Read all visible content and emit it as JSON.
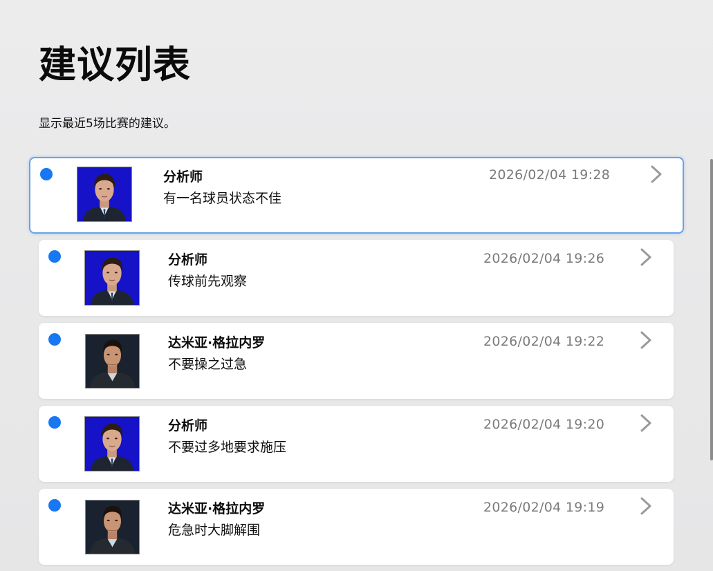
{
  "page": {
    "title": "建议列表",
    "subtitle": "显示最近5场比赛的建议。"
  },
  "colors": {
    "unread_dot": "#1877f2",
    "selected_border": "#6aa3e6",
    "timestamp": "#7b7b7b",
    "avatar_bg": "#1512c8"
  },
  "suggestions": [
    {
      "name": "分析师",
      "message": "有一名球员状态不佳",
      "timestamp": "2026/02/04 19:28",
      "avatar": "analyst-portrait",
      "unread": true,
      "selected": true
    },
    {
      "name": "分析师",
      "message": "传球前先观察",
      "timestamp": "2026/02/04 19:26",
      "avatar": "analyst-portrait",
      "unread": true,
      "selected": false
    },
    {
      "name": "达米亚·格拉内罗",
      "message": "不要操之过急",
      "timestamp": "2026/02/04 19:22",
      "avatar": "coach-portrait",
      "unread": true,
      "selected": false
    },
    {
      "name": "分析师",
      "message": "不要过多地要求施压",
      "timestamp": "2026/02/04 19:20",
      "avatar": "analyst-portrait",
      "unread": true,
      "selected": false
    },
    {
      "name": "达米亚·格拉内罗",
      "message": "危急时大脚解围",
      "timestamp": "2026/02/04 19:19",
      "avatar": "coach-portrait",
      "unread": true,
      "selected": false
    }
  ]
}
